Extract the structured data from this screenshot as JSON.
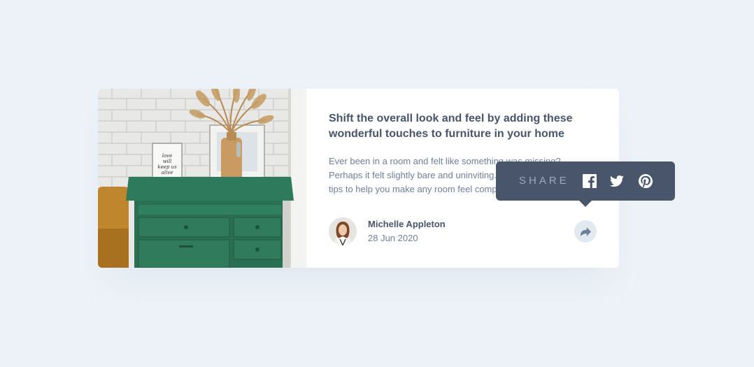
{
  "article": {
    "title": "Shift the overall look and feel by adding these wonderful touches to furniture in your home",
    "excerpt": "Ever been in a room and felt like something was missing? Perhaps it felt slightly bare and uninviting. I’ve got some simple tips to help you make any room feel complete.",
    "image": "drawers-photo"
  },
  "author": {
    "name": "Michelle Appleton",
    "date": "28 Jun 2020",
    "avatar": "avatar-michelle"
  },
  "share": {
    "label": "SHARE",
    "icons": [
      "share-arrow-icon",
      "facebook-icon",
      "twitter-icon",
      "pinterest-icon"
    ]
  },
  "photo_frame_text": [
    "love",
    "will",
    "keep us",
    "alive"
  ],
  "colors": {
    "background": "#ecf2f8",
    "card": "#ffffff",
    "heading": "#48556a",
    "body_text": "#6e8098",
    "popover": "#48556a",
    "share_label": "#9aabbd",
    "share_button": "#e3e9f0"
  }
}
